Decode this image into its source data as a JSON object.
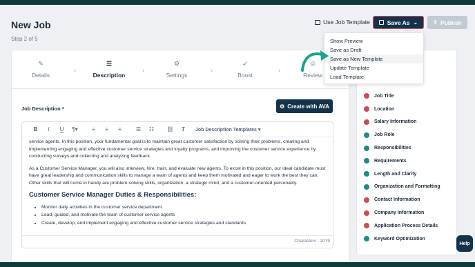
{
  "header": {
    "title": "New Job",
    "step": "Step 2 of 5",
    "use_template": "Use Job Template",
    "save_as": "Save As",
    "publish": "Publish"
  },
  "dropdown": {
    "items": [
      "Show Preview",
      "Save as Draft",
      "Save as New Template",
      "Update Template",
      "Load Template"
    ]
  },
  "steps": [
    {
      "label": "Details",
      "icon": "pencil-icon"
    },
    {
      "label": "Description",
      "icon": "list-icon"
    },
    {
      "label": "Settings",
      "icon": "gear-icon"
    },
    {
      "label": "Boost",
      "icon": "rocket-icon"
    },
    {
      "label": "Review",
      "icon": "check-circle-icon"
    }
  ],
  "editor": {
    "label": "Job Description *",
    "ava_button": "Create with AVA",
    "templates_menu": "Job Description Templates",
    "para1": "service agents. In this position, your fundamental goal is to maintain great customer satisfaction by solving their problems, creating and implementing engaging and effective customer service strategies and loyalty programs, and improving the customer service experience by conducting surveys and collecting and analyzing feedback.",
    "para2": "As a Customer Service Manager, you will also interview, hire, train, and evaluate new agents. To excel in this position, our ideal candidate must have great leadership and communication skills to manage a team of agents and keep them motivated and eager to work the best they can. Other skills that will come in handy are problem-solving skills, organization, a strategic mind, and a customer-oriented personality.",
    "heading": "Customer Service Manager Duties & Responsibilities:",
    "bullets": [
      "Monitor daily activities in the customer service department",
      "Lead, guided, and motivate the team of customer service agents",
      "Create, develop, and implement engaging and effective customer service strategies and standards"
    ],
    "char_count": "Characters : 2079"
  },
  "score": {
    "title": "re",
    "items": [
      {
        "label": "Job Title",
        "status": "red"
      },
      {
        "label": "Location",
        "status": "red"
      },
      {
        "label": "Salary Information",
        "status": "red"
      },
      {
        "label": "Job Role",
        "status": "green"
      },
      {
        "label": "Responsibilities",
        "status": "green"
      },
      {
        "label": "Requirements",
        "status": "green"
      },
      {
        "label": "Length and Clarity",
        "status": "green"
      },
      {
        "label": "Organization and Formatting",
        "status": "green"
      },
      {
        "label": "Contact Information",
        "status": "red"
      },
      {
        "label": "Company Information",
        "status": "red"
      },
      {
        "label": "Application Process Details",
        "status": "red"
      },
      {
        "label": "Keyword Optimization",
        "status": "green"
      }
    ]
  },
  "help": "Help",
  "colors": {
    "primary": "#14324a",
    "accent_red": "#cc4b57",
    "accent_green": "#1e8c84",
    "highlight_border": "#d14b63"
  }
}
